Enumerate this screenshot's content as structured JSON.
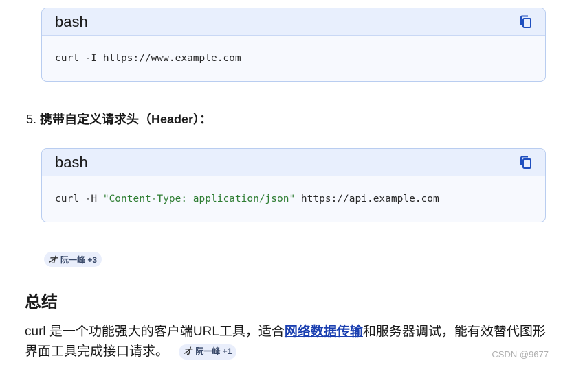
{
  "code_blocks": [
    {
      "language": "bash",
      "code": "curl -I https://www.example.com"
    },
    {
      "language": "bash",
      "code_prefix": "curl -H ",
      "code_string": "\"Content-Type: application/json\"",
      "code_suffix": " https://api.example.com"
    }
  ],
  "step": {
    "number": "5.",
    "title": "携带自定义请求头（Header）："
  },
  "source_chips": [
    {
      "logo": "才",
      "label": "阮一峰 +3"
    },
    {
      "logo": "才",
      "label": "阮一峰 +1"
    }
  ],
  "summary": {
    "title": "总结",
    "text_before": "curl 是一个功能强大的客户端URL工具，适合",
    "link": "网络数据传输",
    "text_after": "和服务器调试，能有效替代图形界面工具完成接口请求。"
  },
  "watermark": "CSDN @9677",
  "icons": {
    "copy": "copy-icon"
  },
  "colors": {
    "code_header": "#e8effd",
    "code_border": "#b9cdf0",
    "string": "#2e7d32",
    "link": "#1a3fb0"
  }
}
